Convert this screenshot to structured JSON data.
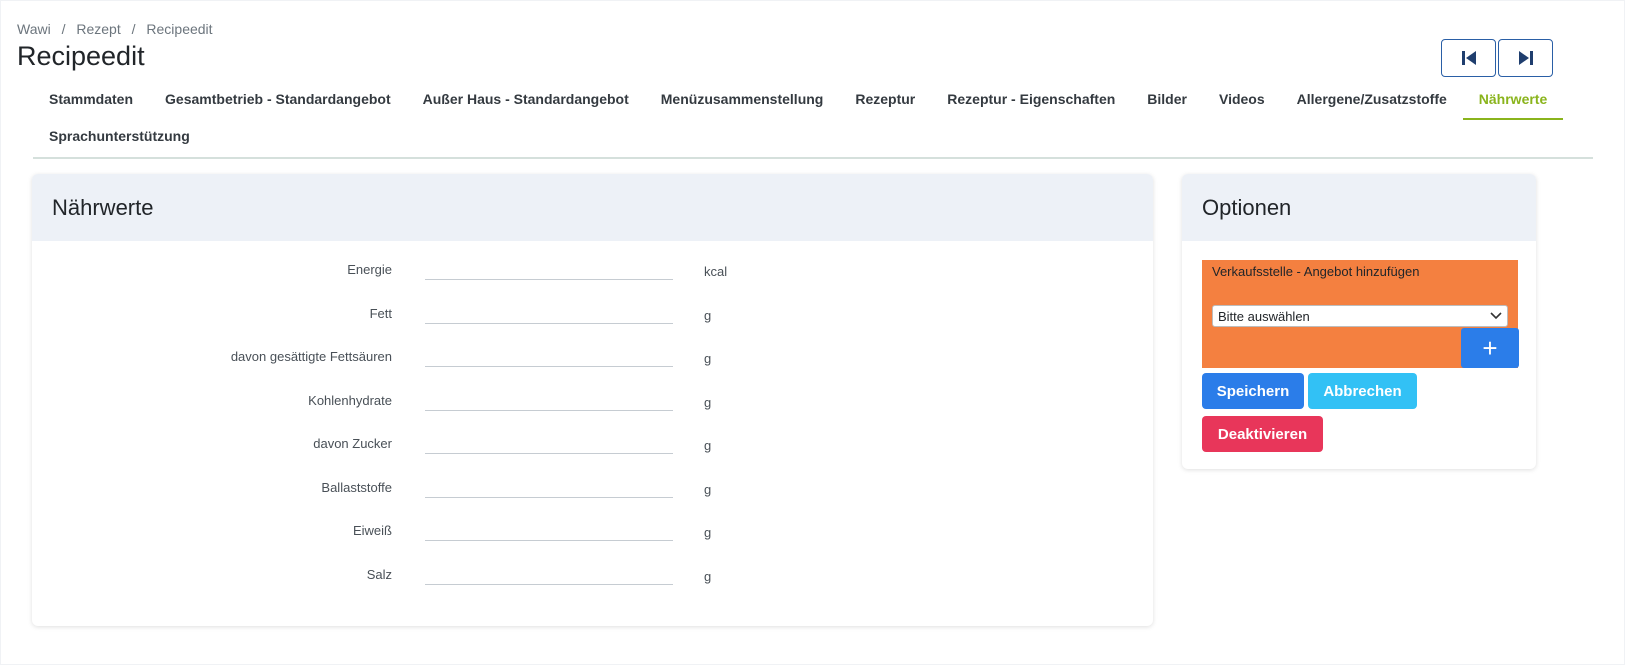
{
  "breadcrumb": [
    "Wawi",
    "Rezept",
    "Recipeedit"
  ],
  "breadcrumb_separator": "/",
  "page_title": "Recipeedit",
  "nav": {
    "first_icon": "skip-back-icon",
    "last_icon": "skip-forward-icon"
  },
  "tabs": {
    "row1": [
      "Stammdaten",
      "Gesamtbetrieb - Standardangebot",
      "Außer Haus - Standardangebot",
      "Menüzusammenstellung",
      "Rezeptur",
      "Rezeptur - Eigenschaften",
      "Bilder",
      "Videos",
      "Allergene/Zusatzstoffe",
      "Nährwerte"
    ],
    "row2": [
      "Sprachunterstützung"
    ],
    "active": "Nährwerte"
  },
  "naehrwerte": {
    "title": "Nährwerte",
    "fields": [
      {
        "label": "Energie",
        "value": "",
        "unit": "kcal"
      },
      {
        "label": "Fett",
        "value": "",
        "unit": "g"
      },
      {
        "label": "davon gesättigte Fettsäuren",
        "value": "",
        "unit": "g"
      },
      {
        "label": "Kohlenhydrate",
        "value": "",
        "unit": "g"
      },
      {
        "label": "davon Zucker",
        "value": "",
        "unit": "g"
      },
      {
        "label": "Ballaststoffe",
        "value": "",
        "unit": "g"
      },
      {
        "label": "Eiweiß",
        "value": "",
        "unit": "g"
      },
      {
        "label": "Salz",
        "value": "",
        "unit": "g"
      }
    ]
  },
  "optionen": {
    "title": "Optionen",
    "verkaufsstelle_label": "Verkaufsstelle - Angebot hinzufügen",
    "select_value": "Bitte auswählen",
    "add_label": "+",
    "save_label": "Speichern",
    "cancel_label": "Abbrechen",
    "deactivate_label": "Deaktivieren"
  },
  "colors": {
    "accent_active_tab": "#8ab41c",
    "orange_box": "#f48040",
    "primary": "#2b7de9",
    "info": "#32c1f5",
    "danger": "#e8365a",
    "nav_border": "#2a5fa6"
  }
}
